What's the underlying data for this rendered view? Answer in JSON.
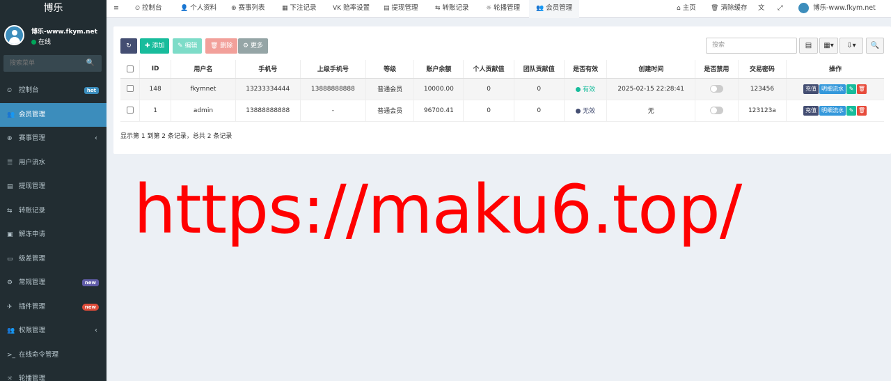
{
  "sidebar": {
    "brand": "博乐",
    "user_name": "博乐-www.fkym.net",
    "user_status": "在线",
    "search_placeholder": "搜索菜单",
    "search_icon": "🔍",
    "items": [
      {
        "icon": "⏲",
        "label": "控制台",
        "badge": "hot"
      },
      {
        "icon": "👥",
        "label": "会员管理"
      },
      {
        "icon": "⊕",
        "label": "赛事管理",
        "chevron": "‹"
      },
      {
        "icon": "☰",
        "label": "用户流水"
      },
      {
        "icon": "▤",
        "label": "提现管理"
      },
      {
        "icon": "⇆",
        "label": "转账记录"
      },
      {
        "icon": "▣",
        "label": "解冻申请"
      },
      {
        "icon": "▭",
        "label": "级差管理"
      },
      {
        "icon": "⚙",
        "label": "常规管理",
        "badge": "new"
      },
      {
        "icon": "✈",
        "label": "插件管理",
        "badge": "new"
      },
      {
        "icon": "👥",
        "label": "权限管理",
        "chevron": "‹"
      },
      {
        "icon": ">_",
        "label": "在线命令管理"
      },
      {
        "icon": "☼",
        "label": "轮播管理"
      }
    ]
  },
  "topbar": {
    "toggle_icon": "≡",
    "tabs": [
      {
        "icon": "⏲",
        "label": "控制台"
      },
      {
        "icon": "👤",
        "label": "个人资料"
      },
      {
        "icon": "⊕",
        "label": "赛事列表"
      },
      {
        "icon": "▦",
        "label": "下注记录"
      },
      {
        "icon": "VK",
        "label": "赔率设置"
      },
      {
        "icon": "▤",
        "label": "提现管理"
      },
      {
        "icon": "⇆",
        "label": "转账记录"
      },
      {
        "icon": "☼",
        "label": "轮播管理"
      },
      {
        "icon": "👥",
        "label": "会员管理"
      }
    ],
    "right": {
      "home_icon": "⌂",
      "home_label": "主页",
      "cache_icon": "🗑",
      "cache_label": "清除缓存",
      "translate_icon": "文",
      "fullscreen_icon": "⤢",
      "user_label": "博乐-www.fkym.net"
    }
  },
  "toolbar": {
    "refresh_icon": "↻",
    "add_label": "✚ 添加",
    "edit_label": "✎ 编辑",
    "delete_label": "🗑 删除",
    "more_label": "⚙ 更多",
    "search_placeholder": "搜索",
    "view_icon": "▤",
    "columns_icon": "▦▾",
    "export_icon": "⇩▾",
    "search_icon": "🔍"
  },
  "table": {
    "headers": [
      "ID",
      "用户名",
      "手机号",
      "上级手机号",
      "等级",
      "账户余额",
      "个人贡献值",
      "团队贡献值",
      "是否有效",
      "创建时间",
      "是否禁用",
      "交易密码",
      "操作"
    ],
    "rows": [
      {
        "id": "148",
        "username": "fkymnet",
        "phone": "13233334444",
        "parent_phone": "13888888888",
        "level": "普通会员",
        "balance": "10000.00",
        "personal": "0",
        "team": "0",
        "valid": "有效",
        "valid_color": "#18bc9c",
        "created": "2025-02-15 22:28:41",
        "trade_pwd": "123456"
      },
      {
        "id": "1",
        "username": "admin",
        "phone": "13888888888",
        "parent_phone": "-",
        "level": "普通会员",
        "balance": "96700.41",
        "personal": "0",
        "team": "0",
        "valid": "无效",
        "valid_color": "#444e72",
        "created": "无",
        "trade_pwd": "123123a"
      }
    ],
    "action_recharge": "充值",
    "action_detail": "明细流水",
    "action_edit_icon": "✎",
    "action_delete_icon": "🗑"
  },
  "footnote": "显示第 1 到第 2 条记录，总共 2 条记录",
  "watermark": "https://maku6.top/"
}
